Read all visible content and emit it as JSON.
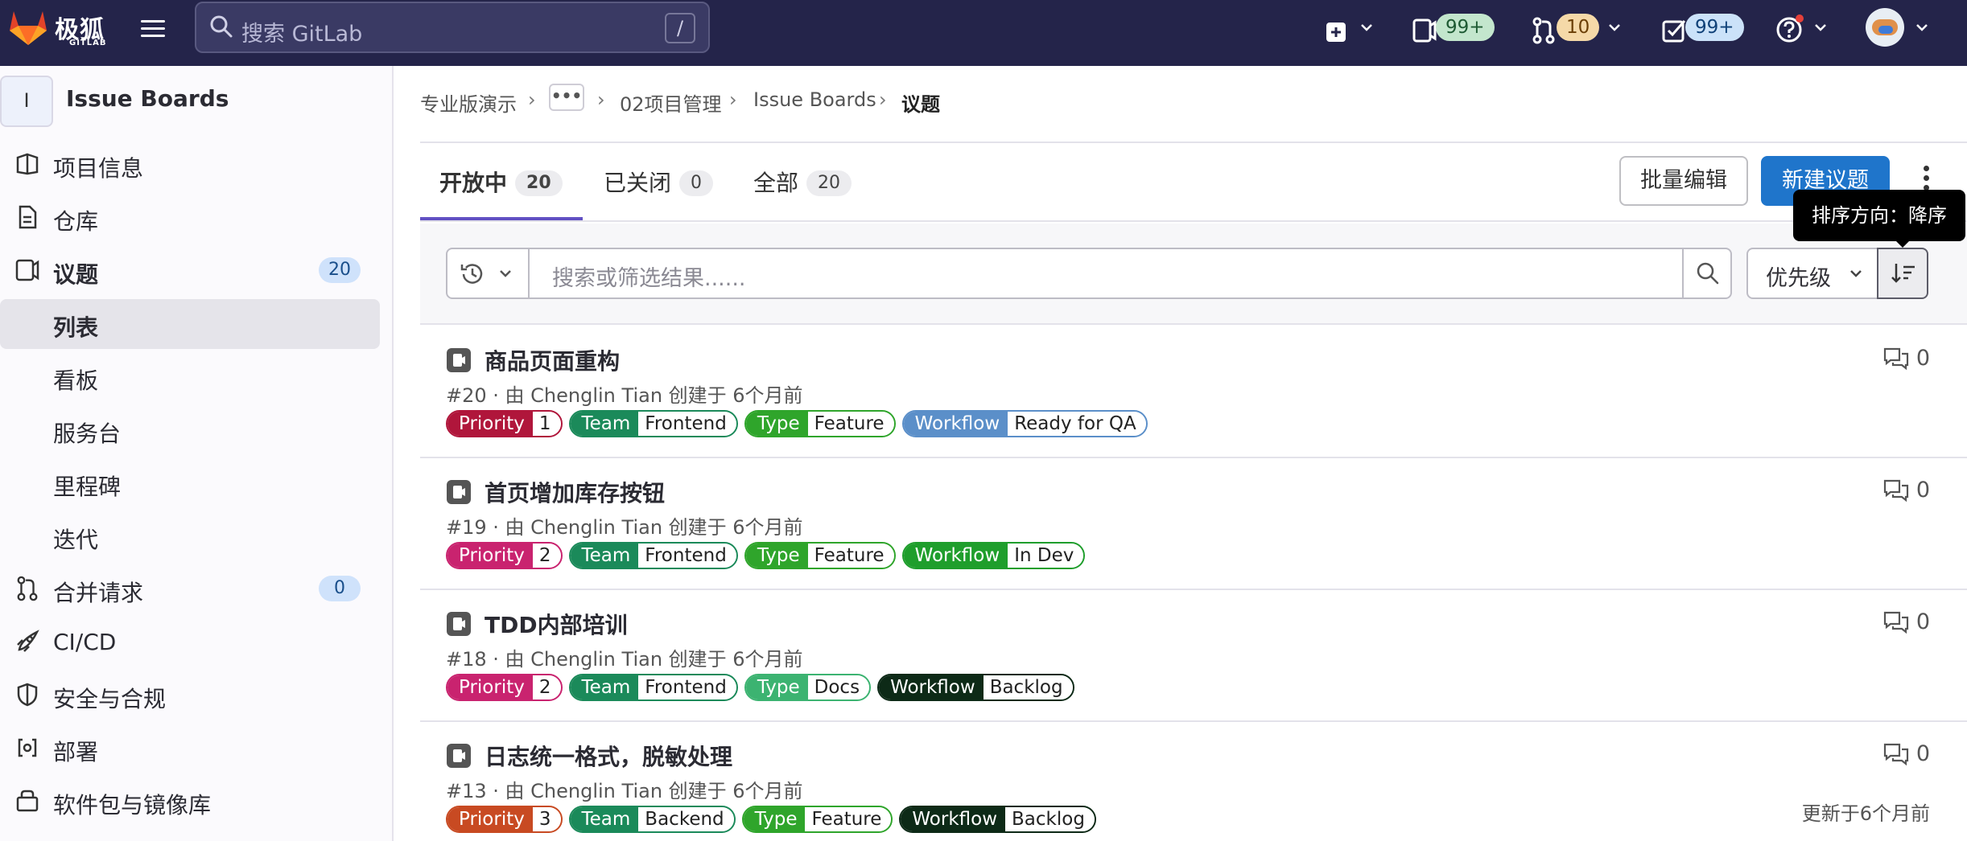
{
  "topbar": {
    "brand_cn": "极狐",
    "brand_en": "GITLAB",
    "search_placeholder": "搜索 GitLab",
    "search_key": "/",
    "issues_badge": "99+",
    "mr_badge": "10",
    "todo_badge": "99+",
    "colors": {
      "bg": "#24244a",
      "green_badge": "#c3e6cd",
      "orange_badge": "#f5d9a8",
      "blue_badge": "#cbe2f9"
    }
  },
  "sidebar": {
    "avatar_letter": "I",
    "project_name": "Issue Boards",
    "items": [
      {
        "label": "项目信息",
        "icon": "project-icon"
      },
      {
        "label": "仓库",
        "icon": "doc-icon"
      },
      {
        "label": "议题",
        "icon": "issues-icon",
        "count": "20"
      },
      {
        "label": "列表",
        "sub": true,
        "active": true
      },
      {
        "label": "看板",
        "sub": true
      },
      {
        "label": "服务台",
        "sub": true
      },
      {
        "label": "里程碑",
        "sub": true
      },
      {
        "label": "迭代",
        "sub": true
      },
      {
        "label": "合并请求",
        "icon": "merge-request-icon",
        "count": "0"
      },
      {
        "label": "CI/CD",
        "icon": "rocket-icon"
      },
      {
        "label": "安全与合规",
        "icon": "shield-icon"
      },
      {
        "label": "部署",
        "icon": "deploy-icon"
      },
      {
        "label": "软件包与镜像库",
        "icon": "package-icon"
      }
    ]
  },
  "breadcrumb": {
    "items": [
      "专业版演示",
      "•••",
      "02项目管理",
      "Issue Boards",
      "议题"
    ]
  },
  "tabs": [
    {
      "label": "开放中",
      "count": "20",
      "active": true
    },
    {
      "label": "已关闭",
      "count": "0"
    },
    {
      "label": "全部",
      "count": "20"
    }
  ],
  "actions": {
    "bulk_edit": "批量编辑",
    "new_issue": "新建议题"
  },
  "filter": {
    "placeholder": "搜索或筛选结果......",
    "sort_label": "优先级",
    "sort_tooltip": "排序方向：降序"
  },
  "issues": [
    {
      "title": "商品页面重构",
      "meta": "#20 · 由 Chenglin Tian 创建于 6个月前",
      "comments": "0",
      "labels": [
        {
          "k": "Priority",
          "v": "1",
          "color": "#b0163b"
        },
        {
          "k": "Team",
          "v": "Frontend",
          "color": "#1b8a5a"
        },
        {
          "k": "Type",
          "v": "Feature",
          "color": "#2fa52b"
        },
        {
          "k": "Workflow",
          "v": "Ready for QA",
          "color": "#5b8fc9"
        }
      ]
    },
    {
      "title": "首页增加库存按钮",
      "meta": "#19 · 由 Chenglin Tian 创建于 6个月前",
      "comments": "0",
      "labels": [
        {
          "k": "Priority",
          "v": "2",
          "color": "#c9236f"
        },
        {
          "k": "Team",
          "v": "Frontend",
          "color": "#1b8a5a"
        },
        {
          "k": "Type",
          "v": "Feature",
          "color": "#2fa52b"
        },
        {
          "k": "Workflow",
          "v": "In Dev",
          "color": "#1f9e2c"
        }
      ]
    },
    {
      "title": "TDD内部培训",
      "meta": "#18 · 由 Chenglin Tian 创建于 6个月前",
      "comments": "0",
      "labels": [
        {
          "k": "Priority",
          "v": "2",
          "color": "#c9236f"
        },
        {
          "k": "Team",
          "v": "Frontend",
          "color": "#1b8a5a"
        },
        {
          "k": "Type",
          "v": "Docs",
          "color": "#3cb371"
        },
        {
          "k": "Workflow",
          "v": "Backlog",
          "color": "#0d2a17"
        }
      ]
    },
    {
      "title": "日志统一格式，脱敏处理",
      "meta": "#13 · 由 Chenglin Tian 创建于 6个月前",
      "comments": "0",
      "updated": "更新于6个月前",
      "labels": [
        {
          "k": "Priority",
          "v": "3",
          "color": "#c84a22"
        },
        {
          "k": "Team",
          "v": "Backend",
          "color": "#1b8a5a"
        },
        {
          "k": "Type",
          "v": "Feature",
          "color": "#2fa52b"
        },
        {
          "k": "Workflow",
          "v": "Backlog",
          "color": "#0d2a17"
        }
      ]
    }
  ]
}
